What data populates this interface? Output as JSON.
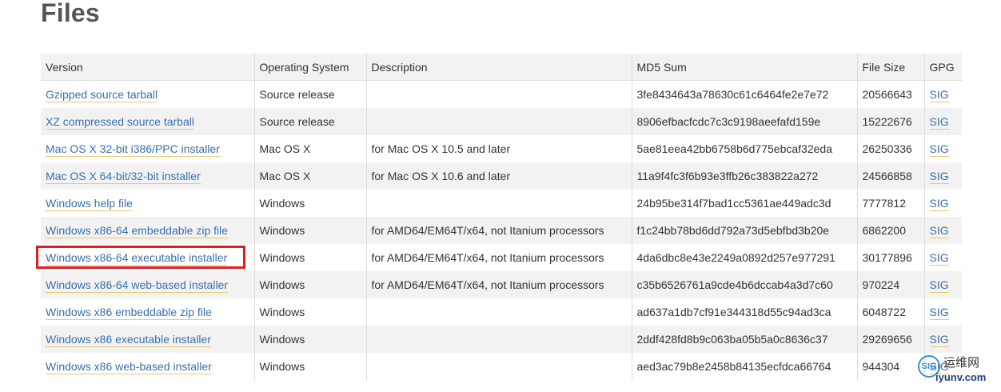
{
  "page": {
    "title": "Files"
  },
  "table": {
    "headers": [
      "Version",
      "Operating System",
      "Description",
      "MD5 Sum",
      "File Size",
      "GPG"
    ],
    "rows": [
      {
        "version": "Gzipped source tarball",
        "os": "Source release",
        "description": "",
        "md5": "3fe8434643a78630c61c6464fe2e7e72",
        "size": "20566643",
        "gpg": "SIG"
      },
      {
        "version": "XZ compressed source tarball",
        "os": "Source release",
        "description": "",
        "md5": "8906efbacfcdc7c3c9198aeefafd159e",
        "size": "15222676",
        "gpg": "SIG"
      },
      {
        "version": "Mac OS X 32-bit i386/PPC installer",
        "os": "Mac OS X",
        "description": "for Mac OS X 10.5 and later",
        "md5": "5ae81eea42bb6758b6d775ebcaf32eda",
        "size": "26250336",
        "gpg": "SIG"
      },
      {
        "version": "Mac OS X 64-bit/32-bit installer",
        "os": "Mac OS X",
        "description": "for Mac OS X 10.6 and later",
        "md5": "11a9f4fc3f6b93e3ffb26c383822a272",
        "size": "24566858",
        "gpg": "SIG"
      },
      {
        "version": "Windows help file",
        "os": "Windows",
        "description": "",
        "md5": "24b95be314f7bad1cc5361ae449adc3d",
        "size": "7777812",
        "gpg": "SIG"
      },
      {
        "version": "Windows x86-64 embeddable zip file",
        "os": "Windows",
        "description": "for AMD64/EM64T/x64, not Itanium processors",
        "md5": "f1c24bb78bd6dd792a73d5ebfbd3b20e",
        "size": "6862200",
        "gpg": "SIG"
      },
      {
        "version": "Windows x86-64 executable installer",
        "os": "Windows",
        "description": "for AMD64/EM64T/x64, not Itanium processors",
        "md5": "4da6dbc8e43e2249a0892d257e977291",
        "size": "30177896",
        "gpg": "SIG"
      },
      {
        "version": "Windows x86-64 web-based installer",
        "os": "Windows",
        "description": "for AMD64/EM64T/x64, not Itanium processors",
        "md5": "c35b6526761a9cde4b6dccab4a3d7c60",
        "size": "970224",
        "gpg": "SIG"
      },
      {
        "version": "Windows x86 embeddable zip file",
        "os": "Windows",
        "description": "",
        "md5": "ad637a1db7cf91e344318d55c94ad3ca",
        "size": "6048722",
        "gpg": "SIG"
      },
      {
        "version": "Windows x86 executable installer",
        "os": "Windows",
        "description": "",
        "md5": "2ddf428fd8b9c063ba05b5a0c8636c37",
        "size": "29269656",
        "gpg": "SIG"
      },
      {
        "version": "Windows x86 web-based installer",
        "os": "Windows",
        "description": "",
        "md5": "aed3ac79b8e2458b84135ecfdca66764",
        "size": "944304",
        "gpg": "SIG"
      }
    ]
  },
  "watermark": {
    "logo_text": "SIG",
    "site_name_cn": "运维网",
    "site_url": "iyunv.com"
  },
  "colors": {
    "link": "#3a6fae",
    "link_underline": "#e8c96a",
    "highlight": "#e02020",
    "stripe": "#f2f2f2"
  }
}
